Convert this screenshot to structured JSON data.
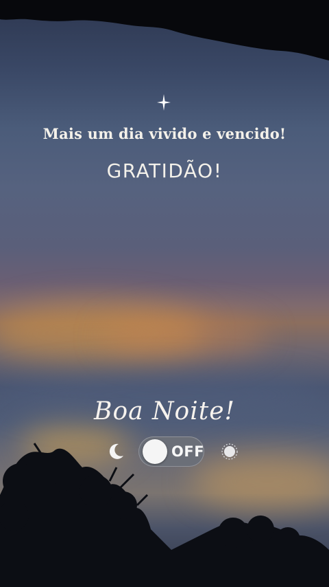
{
  "sparkle_icon": "four-point-star-icon",
  "subtitle": "Mais um dia vivido e vencido!",
  "title": "GRATIDÃO!",
  "goodnight": "Boa Noite!",
  "toggle": {
    "state_label": "OFF",
    "left_icon": "moon-icon",
    "right_icon": "sun-icon"
  },
  "colors": {
    "text": "#f4f1ea",
    "toggle_track": "#6b6f78",
    "toggle_knob": "#f5f5f5"
  }
}
